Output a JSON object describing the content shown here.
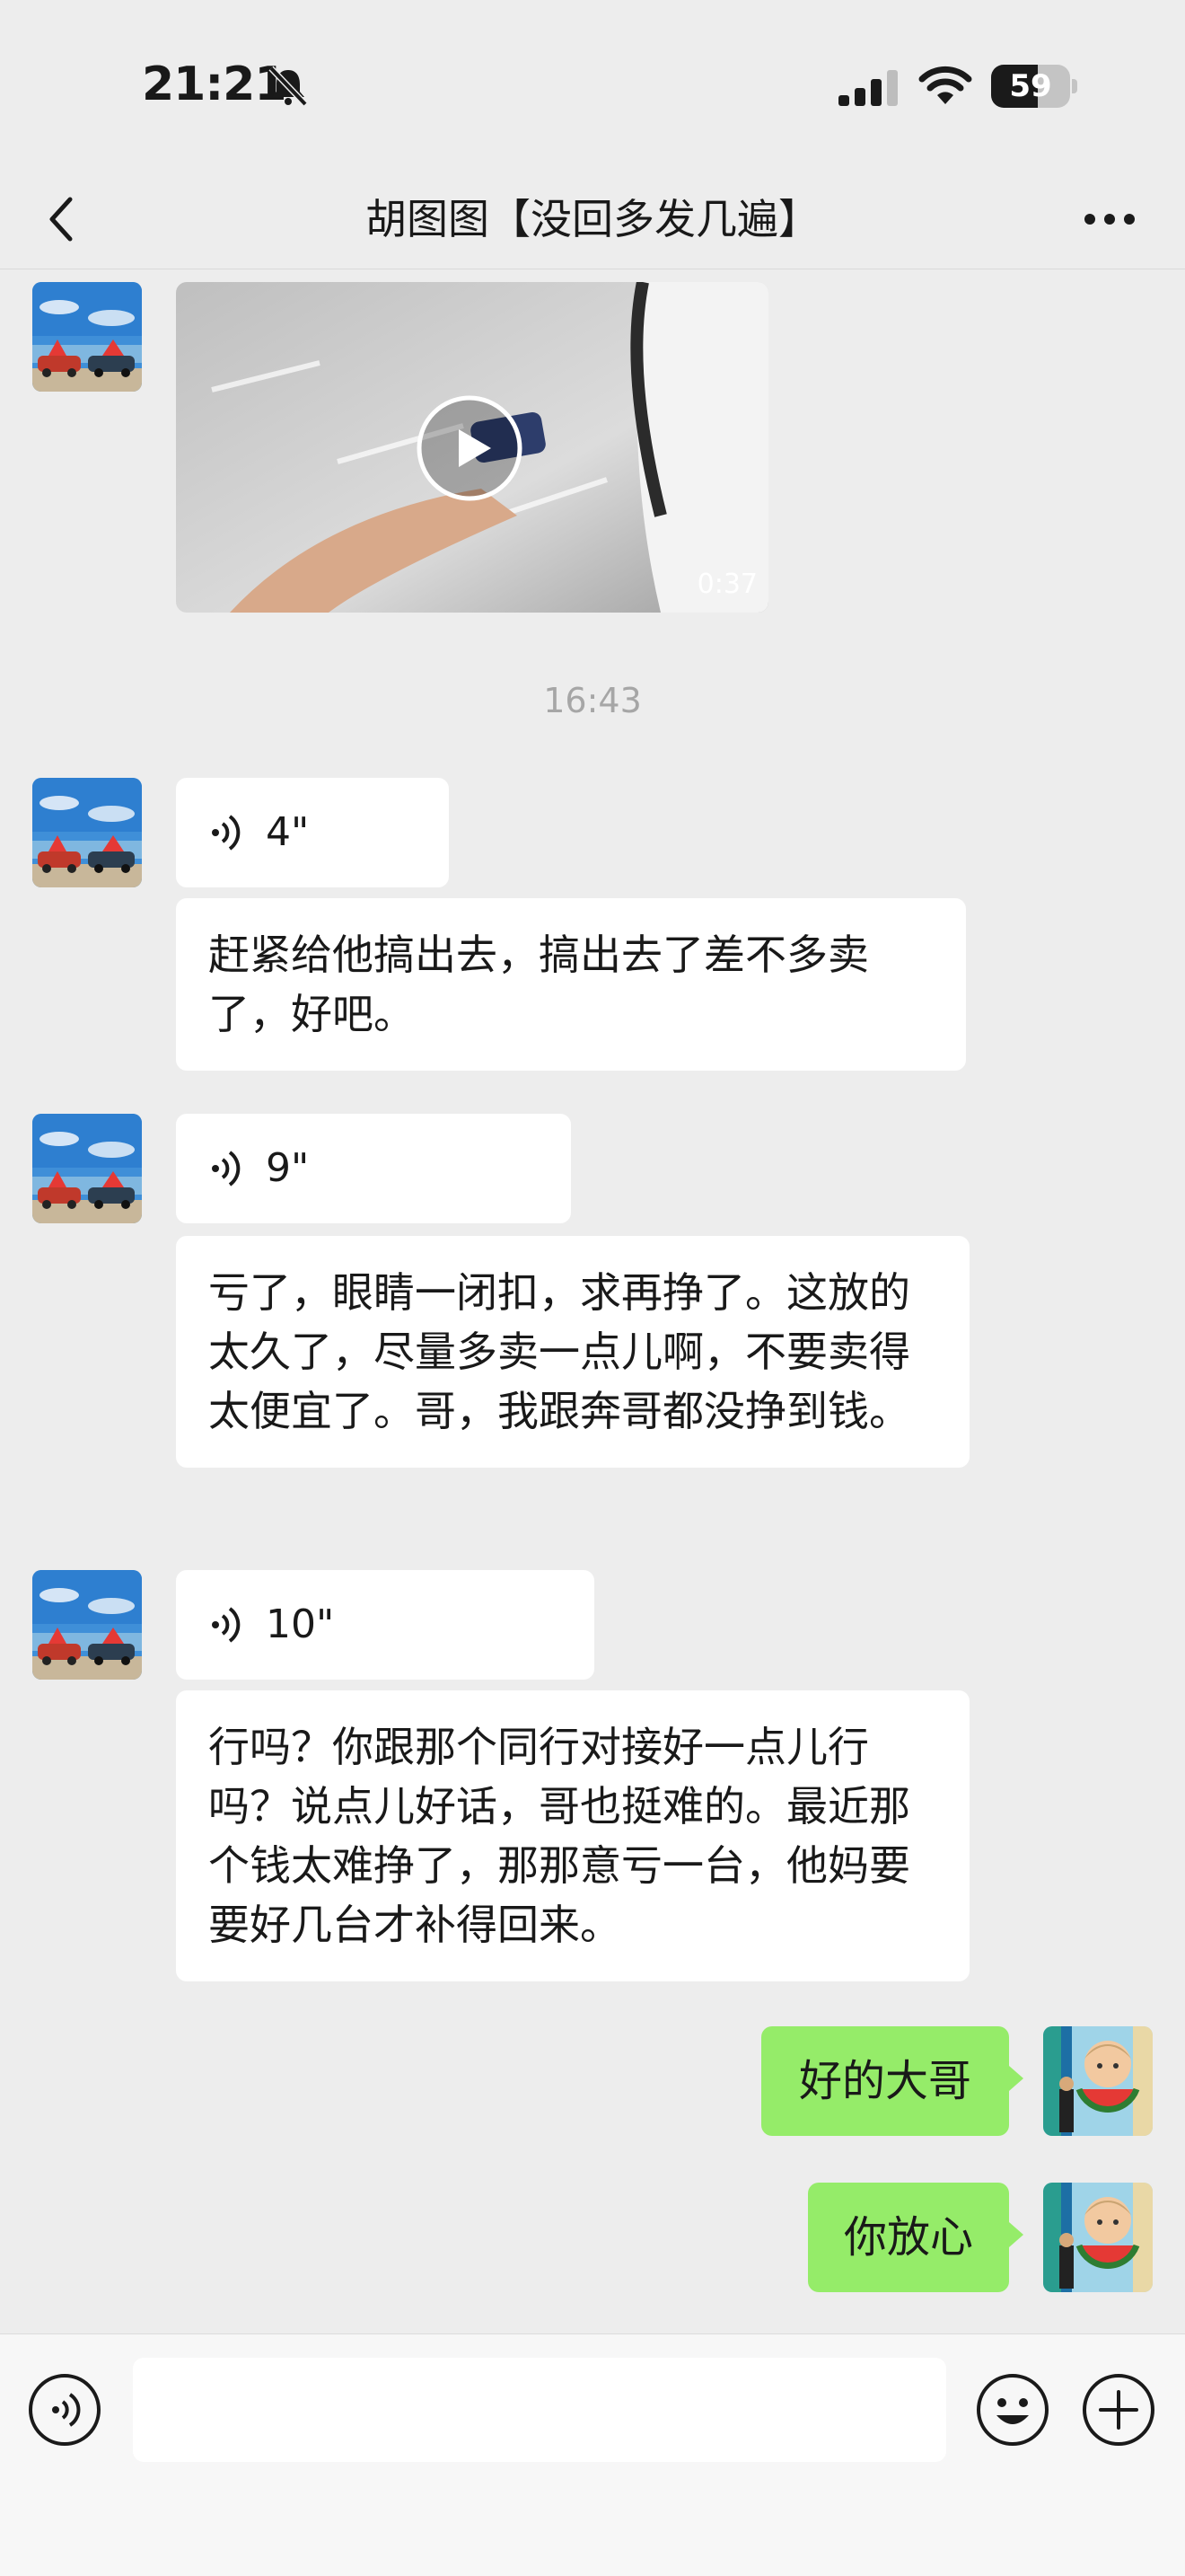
{
  "status_bar": {
    "time": "21:21",
    "battery_text": "59",
    "battery_level": 0.59
  },
  "nav": {
    "title": "胡图图【没回多发几遍】"
  },
  "chat": {
    "video_duration": "0:37",
    "timestamp": "16:43",
    "messages": [
      {
        "voice_duration": "4\"",
        "text": "赶紧给他搞出去，搞出去了差不多卖了，好吧。"
      },
      {
        "voice_duration": "9\"",
        "text": "亏了，眼睛一闭扣，求再挣了。这放的太久了，尽量多卖一点儿啊，不要卖得太便宜了。哥，我跟奔哥都没挣到钱。"
      },
      {
        "voice_duration": "10\"",
        "text": "行吗？你跟那个同行对接好一点儿行吗？说点儿好话，哥也挺难的。最近那个钱太难挣了，那那意亏一台，他妈要要好几台才补得回来。"
      }
    ],
    "my_messages": [
      {
        "text": "好的大哥"
      },
      {
        "text": "你放心"
      }
    ]
  },
  "colors": {
    "background": "#ededed",
    "my_bubble": "#95ec69",
    "their_bubble": "#ffffff"
  },
  "icons": [
    "bell-muted-icon",
    "signal-icon",
    "wifi-icon",
    "back-arrow-icon",
    "more-icon",
    "play-icon",
    "voice-wave-icon",
    "voice-input-icon",
    "emoji-icon",
    "plus-icon"
  ]
}
